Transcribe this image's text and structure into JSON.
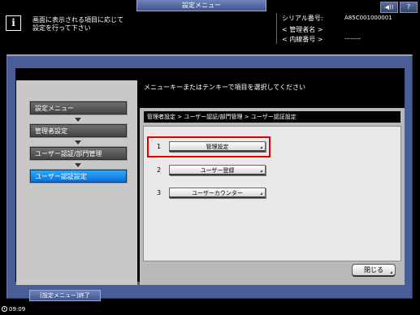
{
  "header": {
    "title": "設定メニュー",
    "message_line1": "画面に表示される項目に応じて",
    "message_line2": "設定を行って下さい",
    "info_icon": "i",
    "speaker_icon": "◀))",
    "help_icon": "?"
  },
  "info": {
    "serial_label": "シリアル番号:",
    "serial_value": "A85C001000001",
    "admin_label": "< 管理者名 >",
    "admin_value": "",
    "extension_label": "< 内線番号 >",
    "extension_value": "--------"
  },
  "breadcrumb": {
    "items": [
      "設定メニュー",
      "管理者設定",
      "ユーザー認証/部門管理",
      "ユーザー認証設定"
    ]
  },
  "main": {
    "prompt": "メニューキーまたはテンキーで項目を選択してください",
    "path": "管理者設定 > ユーザー認証/部門管理 > ユーザー認証設定",
    "menu": [
      {
        "number": "1",
        "label": "管理設定"
      },
      {
        "number": "2",
        "label": "ユーザー登録"
      },
      {
        "number": "3",
        "label": "ユーザーカウンター"
      }
    ],
    "close_label": "閉じる"
  },
  "footer": {
    "exit_label": "[設定メニュー]終了",
    "time": "09:09"
  }
}
